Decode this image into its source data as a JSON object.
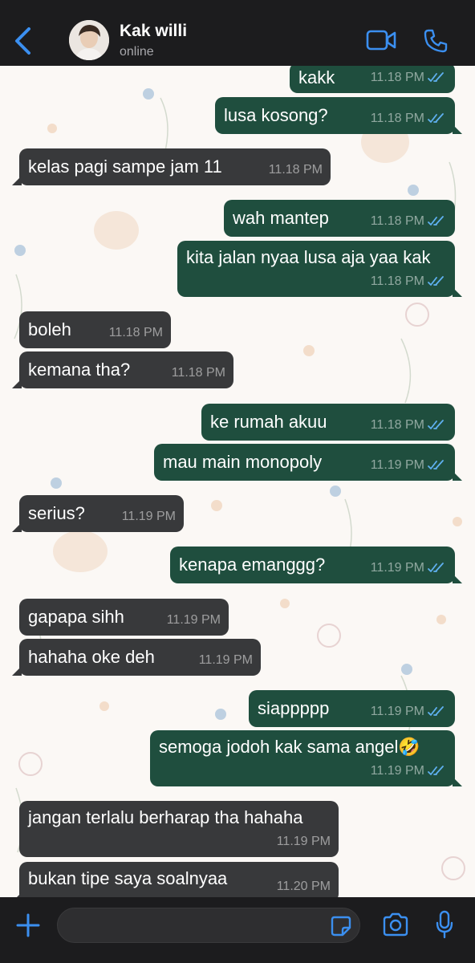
{
  "header": {
    "contact_name": "Kak willi",
    "status": "online",
    "icons": [
      "chevron-left-icon",
      "video-call-icon",
      "phone-call-icon"
    ]
  },
  "messages": [
    {
      "dir": "out",
      "text": "kakk",
      "time": "11.18 PM",
      "read": true
    },
    {
      "dir": "out",
      "text": "lusa kosong?",
      "time": "11.18 PM",
      "read": true
    },
    {
      "dir": "in",
      "text": "kelas pagi sampe jam 11",
      "time": "11.18 PM"
    },
    {
      "dir": "out",
      "text": "wah mantep",
      "time": "11.18 PM",
      "read": true
    },
    {
      "dir": "out",
      "text": "kita jalan nyaa lusa aja yaa kak",
      "time": "11.18 PM",
      "read": true
    },
    {
      "dir": "in",
      "text": "boleh",
      "time": "11.18 PM"
    },
    {
      "dir": "in",
      "text": "kemana tha?",
      "time": "11.18 PM"
    },
    {
      "dir": "out",
      "text": "ke rumah akuu",
      "time": "11.18 PM",
      "read": true
    },
    {
      "dir": "out",
      "text": "mau main monopoly",
      "time": "11.19 PM",
      "read": true
    },
    {
      "dir": "in",
      "text": "serius?",
      "time": "11.19 PM"
    },
    {
      "dir": "out",
      "text": "kenapa emanggg?",
      "time": "11.19 PM",
      "read": true
    },
    {
      "dir": "in",
      "text": "gapapa sihh",
      "time": "11.19 PM"
    },
    {
      "dir": "in",
      "text": "hahaha oke deh",
      "time": "11.19 PM"
    },
    {
      "dir": "out",
      "text": "siappppp",
      "time": "11.19 PM",
      "read": true
    },
    {
      "dir": "out",
      "text": "semoga jodoh kak sama angel🤣",
      "time": "11.19 PM",
      "read": true
    },
    {
      "dir": "in",
      "text": "jangan terlalu berharap tha hahaha",
      "time": "11.19 PM"
    },
    {
      "dir": "in",
      "text": "bukan tipe saya soalnyaa",
      "time": "11.20 PM"
    }
  ],
  "composer": {
    "placeholder": "",
    "icons": [
      "plus-icon",
      "sticker-icon",
      "camera-icon",
      "microphone-icon"
    ]
  },
  "colors": {
    "incoming_bubble": "#38393b",
    "outgoing_bubble": "#1f4e3e",
    "read_ticks": "#5fb0f0",
    "accent": "#3b8ff0"
  }
}
